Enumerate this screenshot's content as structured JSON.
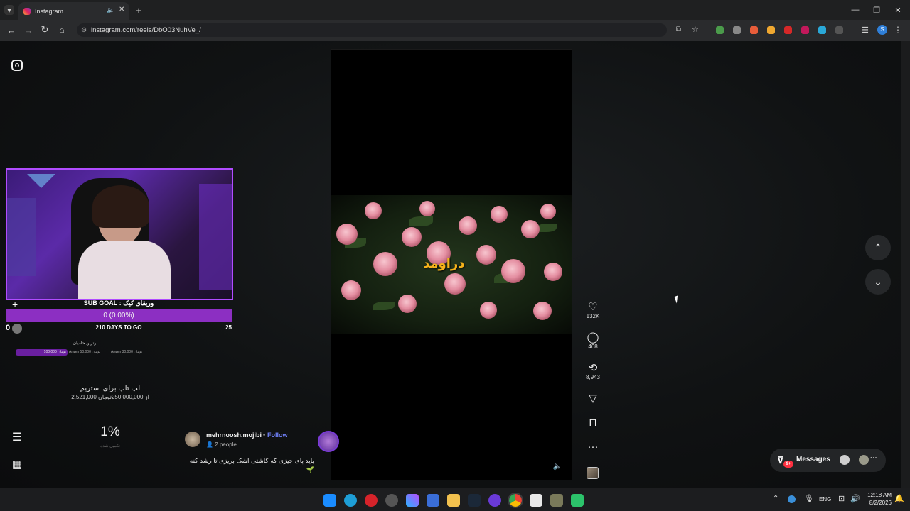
{
  "browser": {
    "tab_title": "Instagram",
    "url": "instagram.com/reels/DbO03NuhVe_/",
    "new_tab": "+",
    "window_min": "—",
    "window_max": "❐",
    "window_close": "✕"
  },
  "stream_overlay": {
    "sub_goal": "SUB GOAL : وریقای کیک",
    "progress_text": "0 (0.00%)",
    "progress_fraction": 0.0,
    "days_left": "210 DAYS TO GO",
    "left_count": "0",
    "right_count": "25",
    "top_donors_title": "برترین حامیان",
    "donor_1": "100,000 تومان",
    "donor_2": "Arwen 50,000 تومان",
    "donor_3": "Arwen 30,000 تومان",
    "laptop_title": "لپ تاپ برای استریم",
    "laptop_amount": "2,521,000 از 250,000,000تومان",
    "percent": "1%",
    "percent_label": "تکمیل شده"
  },
  "reel": {
    "caption_overlay": "دراومد",
    "username": "mehrnoosh.mojibi",
    "follow": "Follow",
    "people": "2 people",
    "caption": "باید پای چیزی که کاشتی اشک بریزی تا رشد کنه 🌱",
    "likes": "132K",
    "comments": "468",
    "reposts": "8,943"
  },
  "sidebar": {
    "menu_icon": "☰",
    "apps_icon": "▦"
  },
  "messages": {
    "label": "Messages",
    "badge": "9+"
  },
  "taskbar": {
    "lang": "ENG",
    "time": "12:18 AM",
    "date": "8/2/2026"
  },
  "colors": {
    "accent_purple": "#8c2fc2",
    "follow_blue": "#6f7ff7",
    "badge_red": "#ff3040"
  }
}
